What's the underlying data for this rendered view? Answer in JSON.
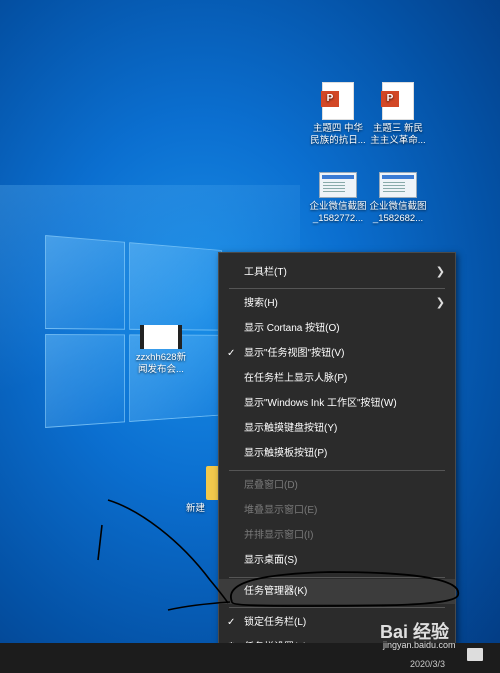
{
  "desktop": {
    "icons": [
      {
        "label_line1": "主题四 中华",
        "label_line2": "民族的抗日...",
        "kind": "ppt"
      },
      {
        "label_line1": "主题三 新民",
        "label_line2": "主主义革命...",
        "kind": "ppt"
      },
      {
        "label_line1": "企业微信截图",
        "label_line2": "_1582772...",
        "kind": "screenshot"
      },
      {
        "label_line1": "企业微信截图",
        "label_line2": "_1582682...",
        "kind": "screenshot"
      },
      {
        "label_line1": "zzxhh628新",
        "label_line2": "闻发布会...",
        "kind": "video"
      },
      {
        "label_line1": "新建",
        "label_line2": "",
        "kind": "folder"
      }
    ]
  },
  "context_menu": {
    "items": [
      {
        "label": "工具栏(T)",
        "has_submenu": true
      },
      {
        "label": "搜索(H)",
        "has_submenu": true
      },
      {
        "label": "显示 Cortana 按钮(O)"
      },
      {
        "label": "显示\"任务视图\"按钮(V)",
        "checked": true
      },
      {
        "label": "在任务栏上显示人脉(P)"
      },
      {
        "label": "显示\"Windows Ink 工作区\"按钮(W)"
      },
      {
        "label": "显示触摸键盘按钮(Y)"
      },
      {
        "label": "显示触摸板按钮(P)"
      },
      {
        "label": "层叠窗口(D)",
        "disabled": true
      },
      {
        "label": "堆叠显示窗口(E)",
        "disabled": true
      },
      {
        "label": "并排显示窗口(I)",
        "disabled": true
      },
      {
        "label": "显示桌面(S)"
      },
      {
        "label": "任务管理器(K)",
        "highlighted": true
      },
      {
        "label": "锁定任务栏(L)",
        "checked": true
      },
      {
        "label": "任务栏设置(T)",
        "icon": "gear-icon"
      }
    ]
  },
  "watermark": {
    "brand": "Bai 经验",
    "url": "jingyan.baidu.com"
  },
  "taskbar": {
    "date": "2020/3/3"
  },
  "colors": {
    "menu_bg": "#2b2b2b",
    "desktop_accent": "#0b6fd0",
    "disabled_text": "#7a7a7a"
  }
}
